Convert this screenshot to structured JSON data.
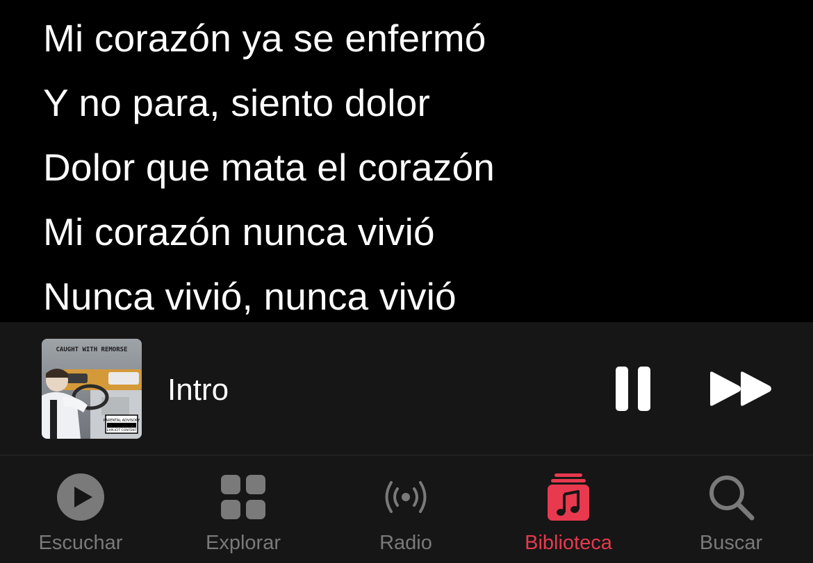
{
  "lyrics": {
    "lines": [
      "Mi corazón ya se enfermó",
      "Y no para, siento dolor",
      "Dolor que mata el corazón",
      "Mi corazón nunca vivió",
      "Nunca vivió, nunca vivió"
    ]
  },
  "now_playing": {
    "title": "Intro",
    "artwork": {
      "cover_text": "CAUGHT WITH REMORSE",
      "advisory_text": "PARENTAL ADVISORY",
      "advisory_sub": "EXPLICIT CONTENT"
    },
    "controls": {
      "pause_icon": "pause-icon",
      "next_icon": "fast-forward-icon"
    }
  },
  "tab_bar": {
    "accent_color": "#e8394e",
    "inactive_color": "#7a7a7a",
    "tabs": [
      {
        "label": "Escuchar",
        "icon": "play-circle-icon",
        "active": false
      },
      {
        "label": "Explorar",
        "icon": "grid-icon",
        "active": false
      },
      {
        "label": "Radio",
        "icon": "broadcast-icon",
        "active": false
      },
      {
        "label": "Biblioteca",
        "icon": "music-library-icon",
        "active": true
      },
      {
        "label": "Buscar",
        "icon": "search-icon",
        "active": false
      }
    ]
  }
}
